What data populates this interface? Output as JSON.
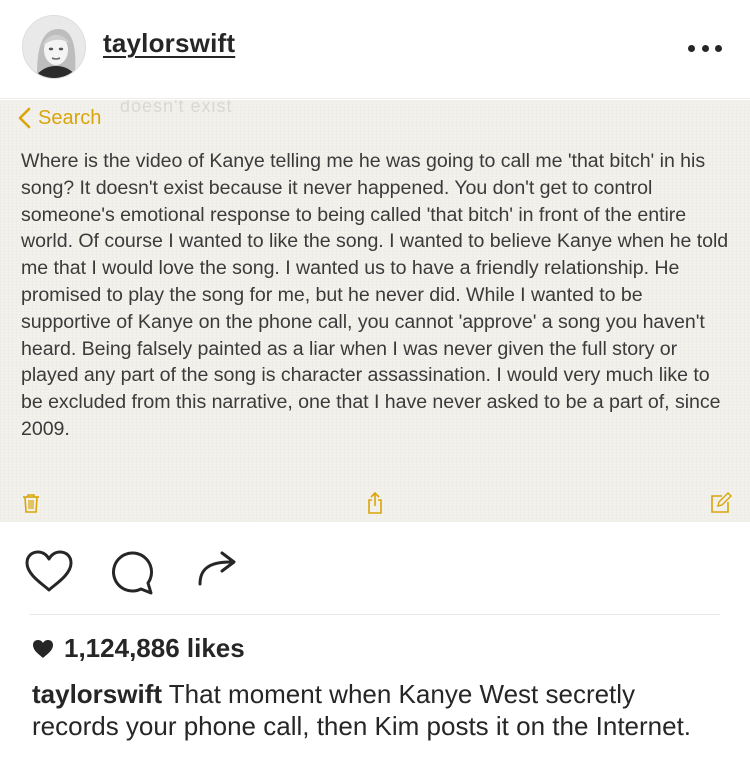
{
  "post": {
    "username": "taylorswift",
    "menu_icon": "more-horizontal-icon"
  },
  "note": {
    "ghost_header": "doesn't exist",
    "back_label": "Search",
    "body": "Where is the video of Kanye telling me he was going to call me 'that bitch' in his song? It doesn't exist because it never happened. You don't get to control someone's emotional response to being called 'that bitch' in front of the entire world. Of course I wanted to like the song. I wanted to believe Kanye when he told me that I would love the song. I wanted us to have a friendly relationship. He promised to play the song for me, but he never did. While I wanted to be supportive of Kanye on the phone call, you cannot 'approve' a song you haven't heard. Being falsely painted as a liar when I was never given the full story or played any part of the song is character assassination. I would very much like to be excluded from this narrative, one that I have never asked to be a part of, since 2009.",
    "accent_color": "#d9a50a",
    "toolbar": [
      "trash-icon",
      "share-icon",
      "compose-icon"
    ]
  },
  "actions": {
    "icons": [
      "heart-icon",
      "comment-icon",
      "share-arrow-icon"
    ]
  },
  "likes": {
    "text": "1,124,886 likes"
  },
  "caption": {
    "username": "taylorswift",
    "text": " That moment when Kanye West secretly records your phone call, then Kim posts it on the Internet."
  }
}
